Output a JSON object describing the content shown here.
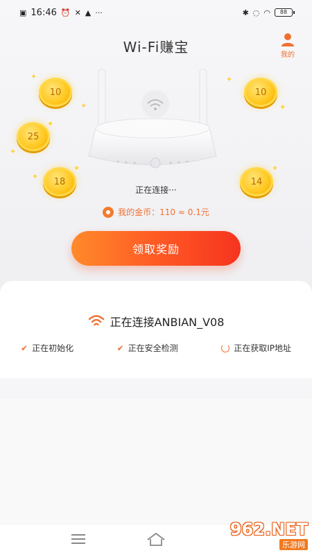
{
  "status_bar": {
    "time": "16:46",
    "battery": "88"
  },
  "header": {
    "title": "Wi-Fi赚宝",
    "me_label": "我的"
  },
  "coins": [
    "10",
    "10",
    "25",
    "18",
    "14"
  ],
  "connection": {
    "status_text": "正在连接···",
    "coins_label": "我的金币：110 ≈ 0.1元"
  },
  "reward_button": "领取奖励",
  "card": {
    "title": "正在连接ANBIAN_V08",
    "steps": [
      "正在初始化",
      "正在安全检测",
      "正在获取IP地址"
    ]
  },
  "watermark": {
    "main": "962.NET",
    "sub": "乐游网"
  },
  "colors": {
    "accent": "#f07030",
    "button_start": "#ff8a2a",
    "button_end": "#f5341f",
    "coin": "#ffc820"
  },
  "icons": {
    "me": "user-icon",
    "wifi": "wifi-icon",
    "step_done": "check-icon",
    "step_loading": "loading-icon",
    "nav_menu": "menu-icon",
    "nav_home": "home-icon"
  }
}
